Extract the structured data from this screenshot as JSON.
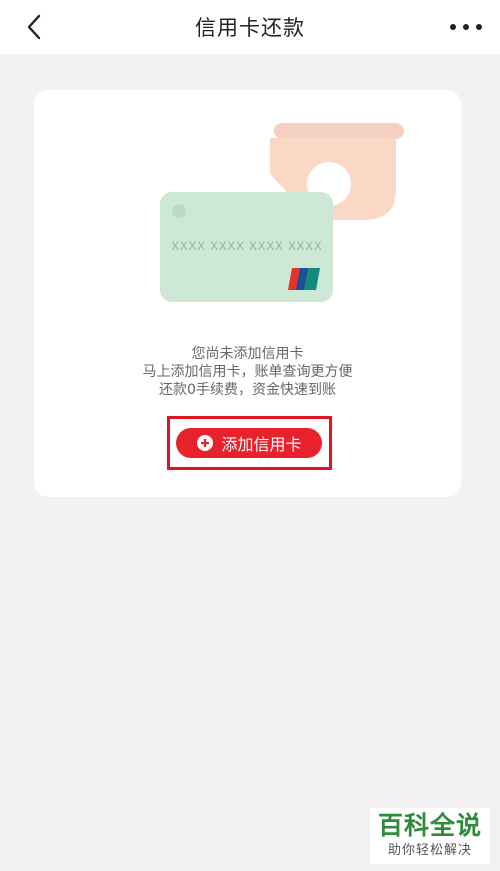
{
  "header": {
    "title": "信用卡还款",
    "back_icon": "chevron-left-icon",
    "more_icon": "more-dots-icon"
  },
  "empty_state": {
    "card_number": "XXXX XXXX XXXX XXXX",
    "line1": "您尚未添加信用卡",
    "line2": "马上添加信用卡，账单查询更方便",
    "line3": "还款0手续费，资金快速到账"
  },
  "add_button": {
    "label": "添加信用卡",
    "icon": "plus-circle-icon",
    "color": "#e8222d"
  },
  "watermark": {
    "title": "百科全说",
    "subtitle": "助你轻松解决"
  }
}
